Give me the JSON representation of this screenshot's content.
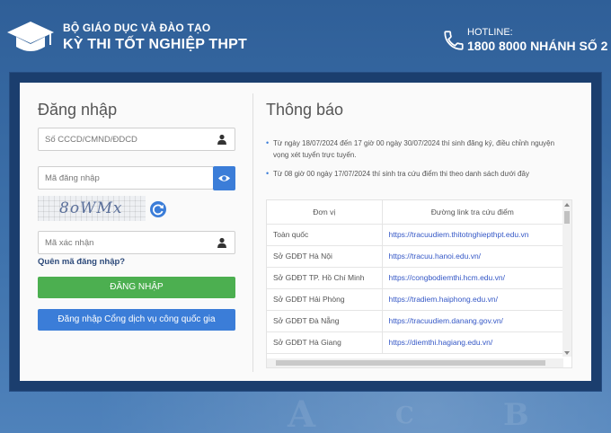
{
  "header": {
    "org_line": "BỘ GIÁO DỤC VÀ ĐÀO TẠO",
    "exam_line": "KỲ THI TỐT NGHIỆP THPT",
    "hotline_label": "HOTLINE:",
    "hotline_number": "1800 8000 NHÁNH SỐ 2"
  },
  "login": {
    "title": "Đăng nhập",
    "id_placeholder": "Số CCCD/CMND/ĐDCD",
    "code_placeholder": "Mã đăng nhập",
    "captcha_text": "8oWMx",
    "verify_placeholder": "Mã xác nhận",
    "forgot_label": "Quên mã đăng nhập?",
    "login_button": "ĐĂNG NHẬP",
    "national_button": "Đăng nhập Cổng dịch vụ công quốc gia"
  },
  "notice": {
    "title": "Thông báo",
    "items": [
      "Từ ngày 18/07/2024 đến 17 giờ 00 ngày 30/07/2024 thí sinh đăng ký, điều chỉnh nguyện vọng xét tuyển trực tuyến.",
      "Từ 08 giờ 00 ngày 17/07/2024 thí sinh tra cứu điểm thi theo danh sách dưới đây"
    ],
    "table": {
      "col_unit": "Đơn vị",
      "col_link": "Đường link tra cứu điểm",
      "rows": [
        {
          "unit": "Toàn quốc",
          "link": "https://tracuudiem.thitotnghiepthpt.edu.vn"
        },
        {
          "unit": "Sở GDĐT Hà Nội",
          "link": "https://tracuu.hanoi.edu.vn/"
        },
        {
          "unit": "Sở GDĐT TP. Hồ Chí Minh",
          "link": "https://congbodiemthi.hcm.edu.vn/"
        },
        {
          "unit": "Sở GDĐT Hải Phòng",
          "link": "https://tradiem.haiphong.edu.vn/"
        },
        {
          "unit": "Sở GDĐT Đà Nẵng",
          "link": "https://tracuudiem.danang.gov.vn/"
        },
        {
          "unit": "Sở GDĐT Hà Giang",
          "link": "https://diemthi.hagiang.edu.vn/"
        }
      ]
    }
  },
  "colors": {
    "background": "#3d6fa8",
    "primary_button": "#3b7dd8",
    "login_button": "#4caf50",
    "link": "#3457c6"
  },
  "icons": [
    "graduation-cap-logo",
    "phone-icon",
    "user-icon",
    "eye-icon",
    "refresh-icon"
  ]
}
